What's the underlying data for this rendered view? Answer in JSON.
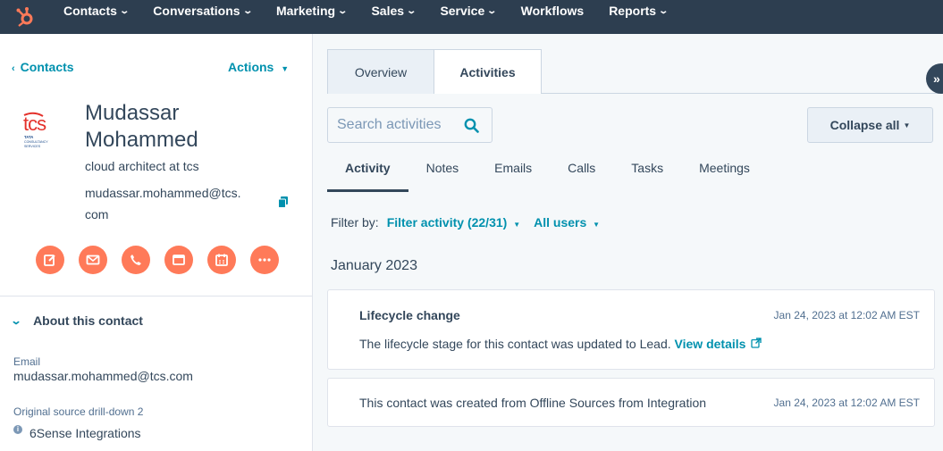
{
  "nav": {
    "items": [
      {
        "label": "Contacts",
        "dropdown": true
      },
      {
        "label": "Conversations",
        "dropdown": true
      },
      {
        "label": "Marketing",
        "dropdown": true
      },
      {
        "label": "Sales",
        "dropdown": true
      },
      {
        "label": "Service",
        "dropdown": true
      },
      {
        "label": "Workflows",
        "dropdown": false
      },
      {
        "label": "Reports",
        "dropdown": true
      }
    ],
    "colors": {
      "bar": "#2d3e50",
      "brand": "#ff7a59"
    }
  },
  "left": {
    "back_label": "Contacts",
    "actions_label": "Actions",
    "name": "Mudassar Mohammed",
    "job": "cloud architect at tcs",
    "email": "mudassar.mohammed@tcs.com",
    "company_logo": {
      "text": "tcs",
      "sub": "TATA CONSULTANCY SERVICES"
    },
    "action_icons": [
      "note-icon",
      "email-icon",
      "call-icon",
      "task-icon",
      "meeting-icon",
      "more-icon"
    ],
    "about_title": "About this contact",
    "properties": [
      {
        "label": "Email",
        "value": "mudassar.mohammed@tcs.com"
      },
      {
        "label": "Original source drill-down 2",
        "value": "6Sense Integrations"
      }
    ]
  },
  "right": {
    "tabs": [
      {
        "label": "Overview"
      },
      {
        "label": "Activities"
      }
    ],
    "active_tab": "Activities",
    "search_placeholder": "Search activities",
    "collapse_label": "Collapse all",
    "subtabs": [
      "Activity",
      "Notes",
      "Emails",
      "Calls",
      "Tasks",
      "Meetings"
    ],
    "filter": {
      "label": "Filter by:",
      "activity": "Filter activity (22/31)",
      "users": "All users"
    },
    "month": "January 2023",
    "activities": [
      {
        "title": "Lifecycle change",
        "body": "The lifecycle stage for this contact was updated to Lead.",
        "link": "View details",
        "time": "Jan 24, 2023 at 12:02 AM EST"
      },
      {
        "title": "",
        "body": "This contact was created from Offline Sources from Integration",
        "link": "",
        "time": "Jan 24, 2023 at 12:02 AM EST"
      }
    ]
  }
}
